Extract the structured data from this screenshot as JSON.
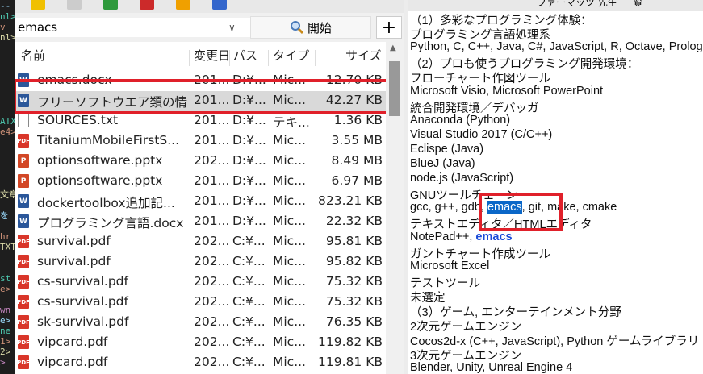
{
  "left_strip": [
    "--",
    "nl>",
    "v",
    "nl>",
    "",
    "",
    "",
    "",
    "",
    "",
    "",
    "ATX",
    "e4>",
    "",
    "",
    "",
    "",
    "",
    "文章",
    "",
    "を 絵",
    "",
    "hr",
    "TXT",
    "",
    "",
    "st",
    "e>",
    "",
    "wn",
    "e>",
    "ne",
    "1>",
    "2>",
    ">"
  ],
  "toolbar": {
    "icons": [
      "#f0c000",
      "#cccccc",
      "#2e9a3c",
      "#cc2a2a",
      "#f0a000",
      "#3366cc"
    ]
  },
  "search": {
    "value": "emacs",
    "placeholder": "",
    "start_label": "開始",
    "plus_label": "+"
  },
  "columns": {
    "name": "名前",
    "modified": "変更日",
    "path": "パス",
    "type": "タイプ",
    "size": "サイズ"
  },
  "files": [
    {
      "name": "emacs.docx",
      "date": "201...",
      "path": "D:¥...",
      "type": "Mic...",
      "size": "12.70 KB",
      "icon": "docx"
    },
    {
      "name": "フリーソフトウエア類の情報....",
      "date": "201...",
      "path": "D:¥...",
      "type": "Mic...",
      "size": "42.27 KB",
      "icon": "docx",
      "selected": true
    },
    {
      "name": "SOURCES.txt",
      "date": "201...",
      "path": "D:¥...",
      "type": "テキ...",
      "size": "1.36 KB",
      "icon": "txt"
    },
    {
      "name": "TitaniumMobileFirstS...",
      "date": "201...",
      "path": "D:¥...",
      "type": "Mic...",
      "size": "3.55 MB",
      "icon": "pdf"
    },
    {
      "name": "optionsoftware.pptx",
      "date": "202...",
      "path": "D:¥...",
      "type": "Mic...",
      "size": "8.49 MB",
      "icon": "pptx"
    },
    {
      "name": "optionsoftware.pptx",
      "date": "201...",
      "path": "D:¥...",
      "type": "Mic...",
      "size": "6.97 MB",
      "icon": "pptx"
    },
    {
      "name": "dockertoolbox追加記...",
      "date": "201...",
      "path": "D:¥...",
      "type": "Mic...",
      "size": "823.21 KB",
      "icon": "docx"
    },
    {
      "name": "プログラミング言語.docx",
      "date": "201...",
      "path": "D:¥...",
      "type": "Mic...",
      "size": "22.32 KB",
      "icon": "docx"
    },
    {
      "name": "survival.pdf",
      "date": "202...",
      "path": "C:¥...",
      "type": "Mic...",
      "size": "95.81 KB",
      "icon": "pdf"
    },
    {
      "name": "survival.pdf",
      "date": "202...",
      "path": "C:¥...",
      "type": "Mic...",
      "size": "95.82 KB",
      "icon": "pdf"
    },
    {
      "name": "cs-survival.pdf",
      "date": "202...",
      "path": "C:¥...",
      "type": "Mic...",
      "size": "75.32 KB",
      "icon": "pdf"
    },
    {
      "name": "cs-survival.pdf",
      "date": "202...",
      "path": "C:¥...",
      "type": "Mic...",
      "size": "75.32 KB",
      "icon": "pdf"
    },
    {
      "name": "sk-survival.pdf",
      "date": "202...",
      "path": "C:¥...",
      "type": "Mic...",
      "size": "76.35 KB",
      "icon": "pdf"
    },
    {
      "name": "vipcard.pdf",
      "date": "202...",
      "path": "C:¥...",
      "type": "Mic...",
      "size": "119.82 KB",
      "icon": "pdf"
    },
    {
      "name": "vipcard.pdf",
      "date": "202...",
      "path": "C:¥...",
      "type": "Mic...",
      "size": "119.81 KB",
      "icon": "pdf"
    }
  ],
  "preview": {
    "top_partial": "ファーマッツ 先生 一 覧",
    "lines": [
      {
        "text": "（1）多彩なプログラミング体験："
      },
      {
        "text": "プログラミング言語処理系"
      },
      {
        "text": "Python, C, C++, Java, C#, JavaScript, R, Octave, Prolog"
      },
      {
        "text": "（2）プロも使うプログラミング開発環境："
      },
      {
        "text": "フローチャート作図ツール"
      },
      {
        "text": "Microsoft Visio, Microsoft PowerPoint"
      },
      {
        "text": "統合開発環境／デバッガ"
      },
      {
        "text": "Anaconda (Python)"
      },
      {
        "text": "Visual Studio 2017 (C/C++)"
      },
      {
        "text": "Eclispe (Java)"
      },
      {
        "text": "BlueJ (Java)"
      },
      {
        "text": "node.js (JavaScript)"
      },
      {
        "text": "GNUツールチェーン"
      },
      {
        "pre": "gcc, g++, gdb, ",
        "hl": "emacs",
        "post": ", git, make, cmake"
      },
      {
        "text": "テキストエディタ／HTMLエディタ"
      },
      {
        "pre": "NotePad++, ",
        "blue": "emacs",
        "post": ""
      },
      {
        "text": "ガントチャート作成ツール"
      },
      {
        "text": "Microsoft Excel"
      },
      {
        "text": "テストツール"
      },
      {
        "text": "未選定"
      },
      {
        "text": "（3）ゲーム, エンターテインメント分野"
      },
      {
        "text": "2次元ゲームエンジン"
      },
      {
        "text": "Cocos2d-x (C++, JavaScript), Python ゲームライブラリ"
      },
      {
        "text": "3次元ゲームエンジン"
      },
      {
        "text": "Blender, Unity, Unreal Engine 4"
      }
    ]
  },
  "colors": {
    "highlight_box": "#e0202a",
    "selection": "#0a67c8"
  }
}
